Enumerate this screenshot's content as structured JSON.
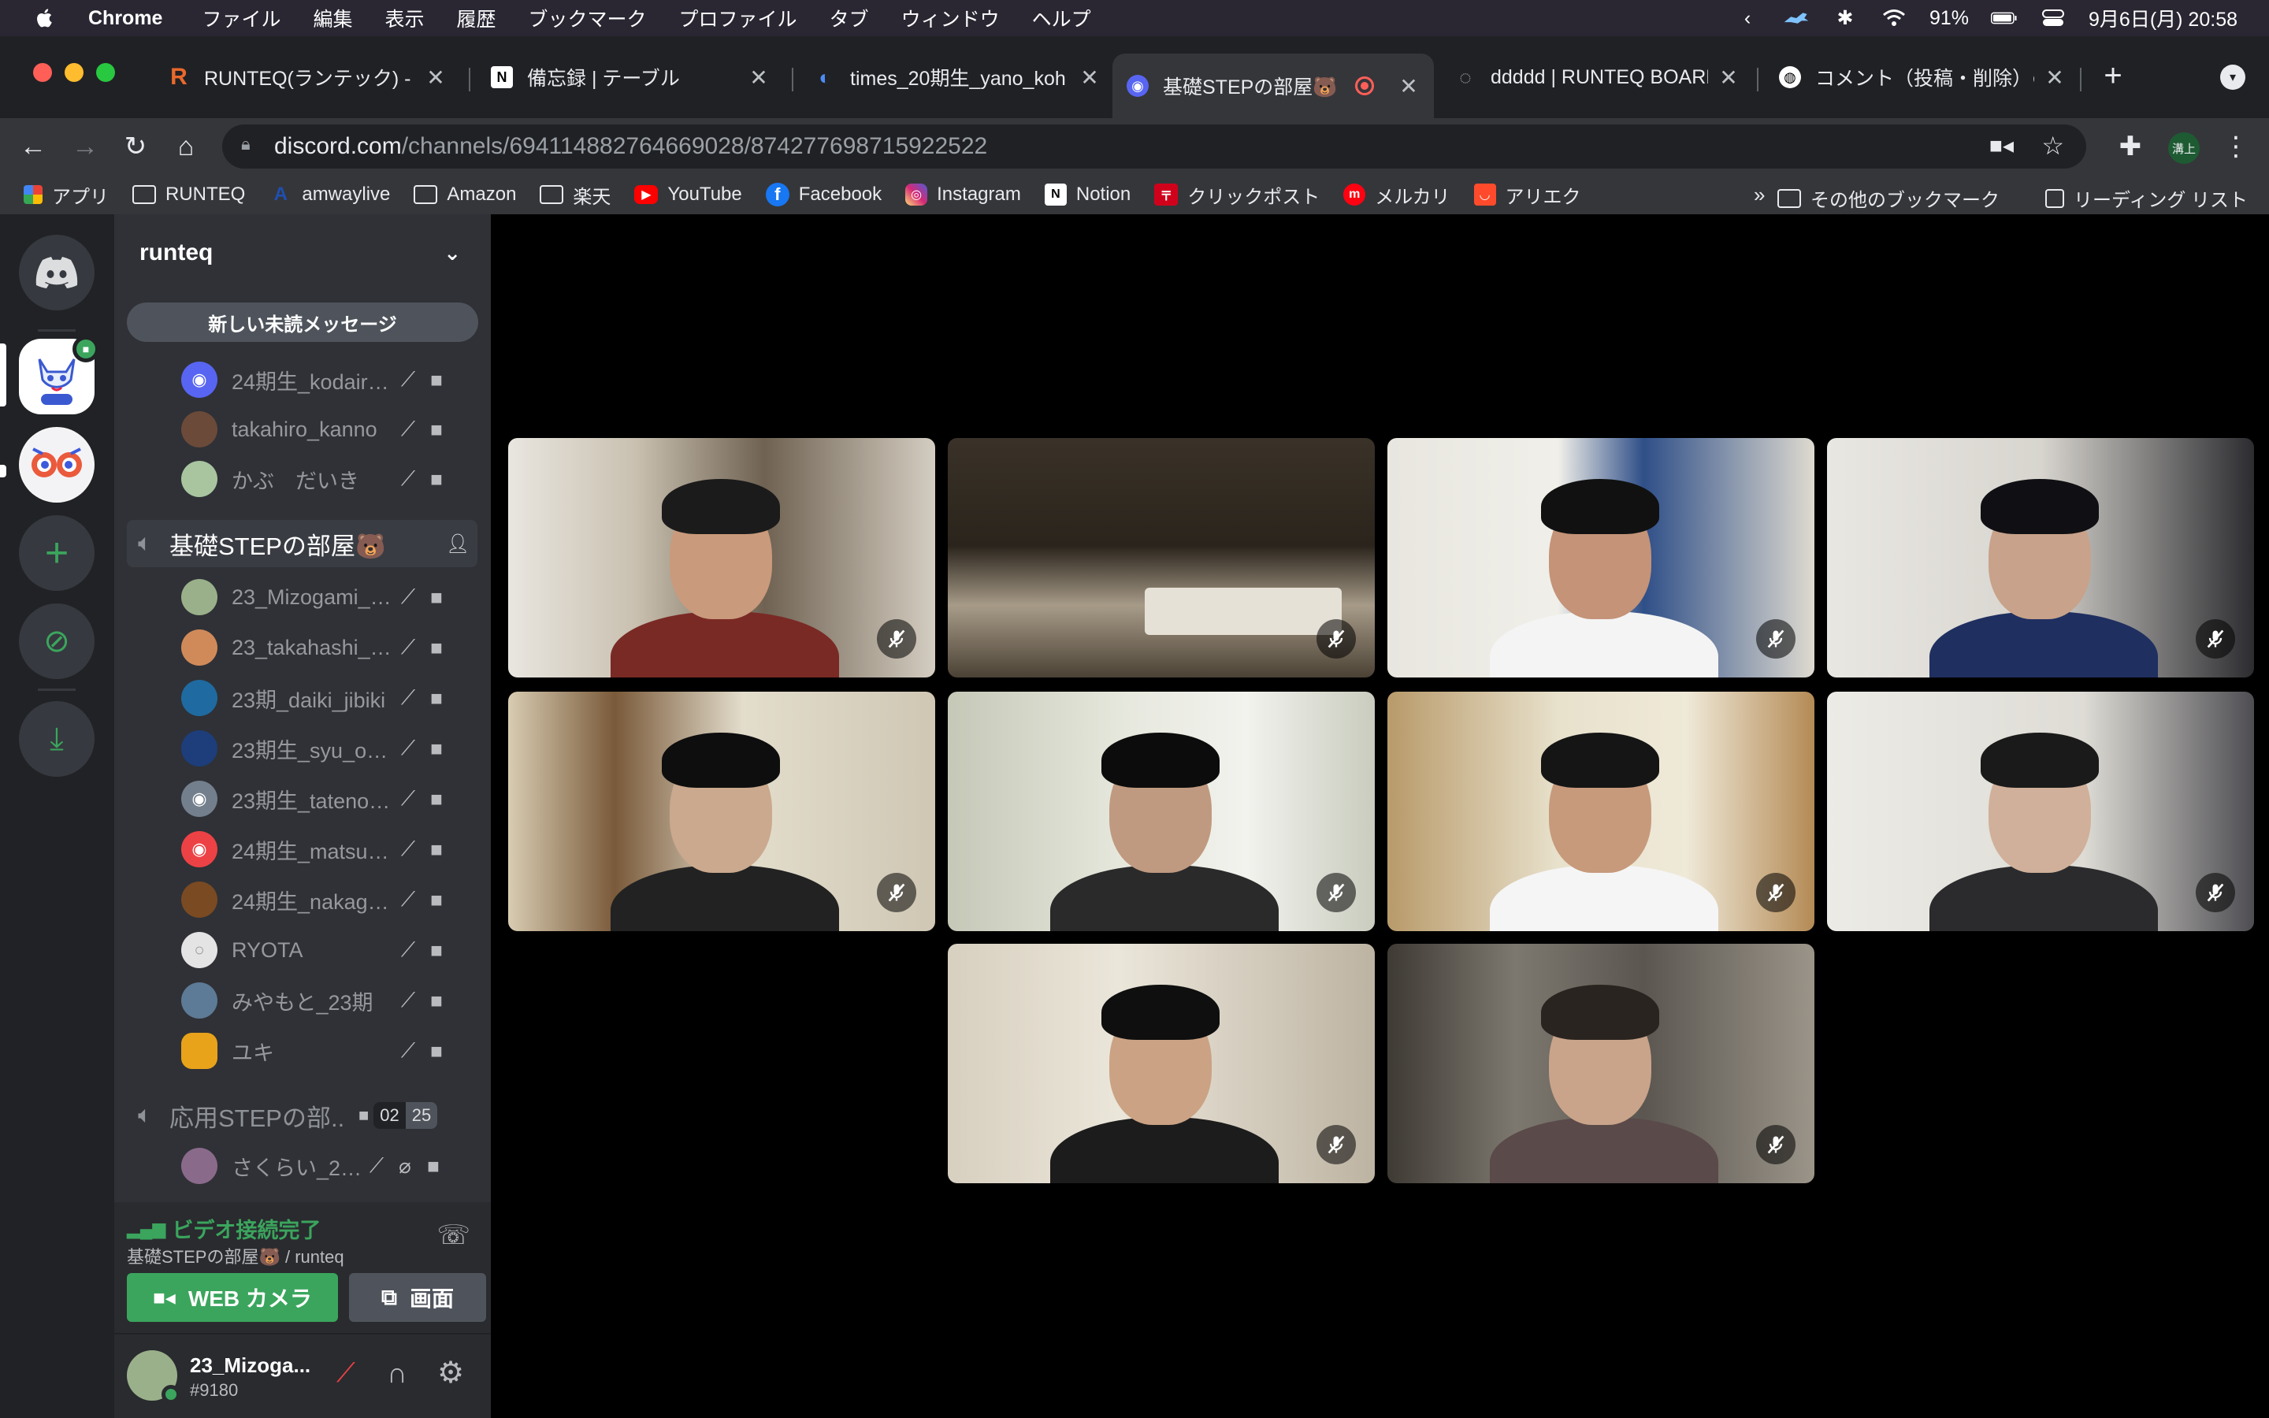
{
  "menubar": {
    "app": "Chrome",
    "items": [
      "ファイル",
      "編集",
      "表示",
      "履歴",
      "ブックマーク",
      "プロファイル",
      "タブ",
      "ウィンドウ",
      "ヘルプ"
    ],
    "battery": "91%",
    "datetime": "9月6日(月)  20:58"
  },
  "tabs": [
    {
      "title": "RUNTEQ(ランテック) - W",
      "favicon": "R",
      "color": "#e8692c"
    },
    {
      "title": "備忘録 | テーブル",
      "favicon": "N",
      "color": "#ffffff"
    },
    {
      "title": "times_20期生_yano_koh",
      "favicon": "◐",
      "color": "#4c8bf5"
    },
    {
      "title": "基礎STEPの部屋🐻",
      "favicon": "◉",
      "color": "#5865f2"
    },
    {
      "title": "ddddd | RUNTEQ BOARD",
      "favicon": "◌",
      "color": "#9aa0a6"
    },
    {
      "title": "コメント（投稿・削除）のA",
      "favicon": "◍",
      "color": "#ffffff"
    }
  ],
  "address": {
    "host": "discord.com",
    "path": "/channels/694114882764669028/874277698715922522"
  },
  "profile_badge": "溝上",
  "bookmarks": [
    {
      "label": "アプリ",
      "icon": "apps-icon"
    },
    {
      "label": "RUNTEQ",
      "icon": "folder-icon"
    },
    {
      "label": "amwaylive",
      "icon": "amway-icon"
    },
    {
      "label": "Amazon",
      "icon": "folder-icon"
    },
    {
      "label": "楽天",
      "icon": "folder-icon"
    },
    {
      "label": "YouTube",
      "icon": "youtube-icon"
    },
    {
      "label": "Facebook",
      "icon": "facebook-icon"
    },
    {
      "label": "Instagram",
      "icon": "instagram-icon"
    },
    {
      "label": "Notion",
      "icon": "notion-icon"
    },
    {
      "label": "クリックポスト",
      "icon": "clickpost-icon"
    },
    {
      "label": "メルカリ",
      "icon": "mercari-icon"
    },
    {
      "label": "アリエク",
      "icon": "aliexpress-icon"
    }
  ],
  "bookmarks_right": {
    "more": "»",
    "other": "その他のブックマーク",
    "reading": "リーディング リスト"
  },
  "discord": {
    "server_name": "runteq",
    "unread_pill": "新しい未読メッセージ",
    "top_members": [
      "24期生_kodaira...",
      "takahiro_kanno",
      "かぶ　だいき"
    ],
    "voice_channel": "基礎STEPの部屋🐻",
    "voice_members": [
      "23_Mizogami_A...",
      "23_takahashi_sh...",
      "23期_daiki_jibiki",
      "23期生_syu_ono...",
      "23期生_tateno_...",
      "24期生_matsuki...",
      "24期生_nakaga...",
      "RYOTA",
      "みやもと_23期",
      "ユキ"
    ],
    "other_channel": "応用STEPの部...",
    "other_channel_count_a": "02",
    "other_channel_count_b": "25",
    "other_member": "さくらい_22...",
    "voice_status": "ビデオ接続完了",
    "voice_location": "基礎STEPの部屋🐻 / runteq",
    "camera_button": "WEB カメラ",
    "screen_button": "画面",
    "user_name": "23_Mizoga...",
    "user_tag": "#9180"
  },
  "colors": {
    "green": "#3ba55d",
    "blurple": "#5865f2",
    "red": "#ed4245"
  }
}
